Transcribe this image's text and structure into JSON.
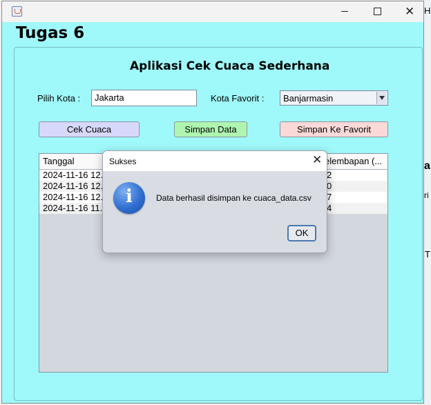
{
  "background_fragments": [
    "He",
    "a",
    "ri",
    "T"
  ],
  "window": {
    "title": ""
  },
  "header": {
    "heading": "Tugas 6"
  },
  "form": {
    "title": "Aplikasi Cek Cuaca Sederhana",
    "city_label": "Pilih Kota :",
    "city_value": "Jakarta",
    "favorite_label": "Kota Favorit :",
    "favorite_selected": "Banjarmasin",
    "buttons": {
      "check": "Cek Cuaca",
      "save": "Simpan Data",
      "save_favorite": "Simpan Ke Favorit"
    },
    "colors": {
      "check": "#d7d8fb",
      "save": "#aef6b0",
      "save_favorite": "#fbd9d9",
      "background": "#9ff8f9"
    }
  },
  "table": {
    "columns": [
      "Tanggal",
      "elembapan (..."
    ],
    "rows": [
      [
        "2024-11-16 12...",
        "2"
      ],
      [
        "2024-11-16 12...",
        "0"
      ],
      [
        "2024-11-16 12...",
        "7"
      ],
      [
        "2024-11-16 11...",
        "4"
      ]
    ]
  },
  "dialog": {
    "title": "Sukses",
    "message": "Data berhasil disimpan ke cuaca_data.csv",
    "ok_label": "OK",
    "icon": "info-icon"
  }
}
